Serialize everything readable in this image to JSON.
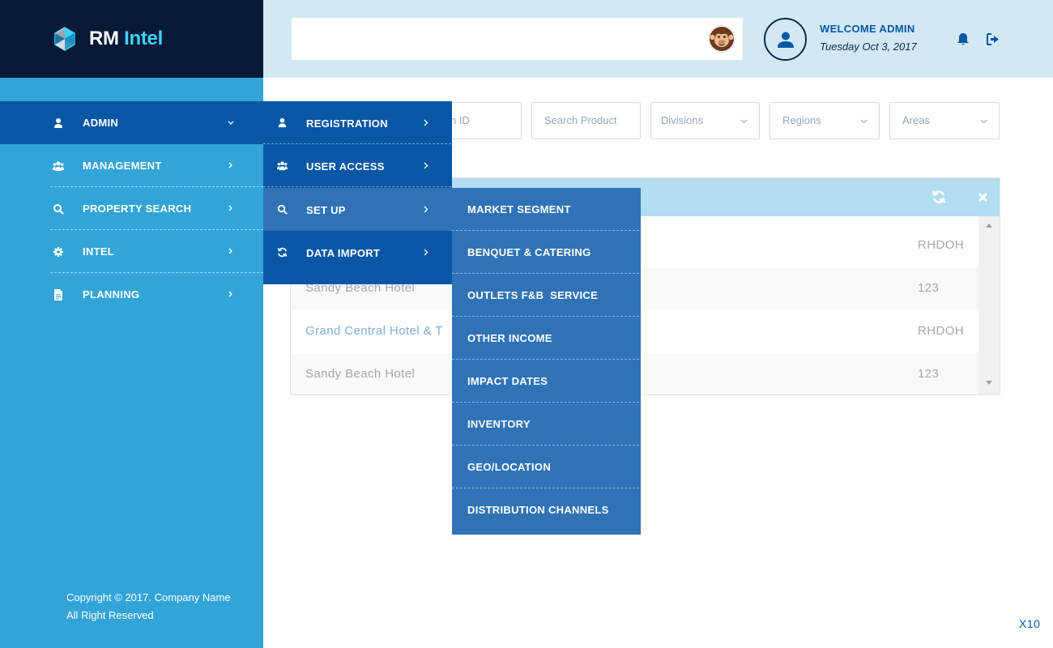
{
  "brand": {
    "name_part1": "RM",
    "name_part2": "Intel"
  },
  "sidebar": {
    "items": [
      {
        "label": "ADMIN",
        "icon": "user-icon",
        "active": true
      },
      {
        "label": "MANAGEMENT",
        "icon": "users-icon"
      },
      {
        "label": "PROPERTY SEARCH",
        "icon": "search-icon"
      },
      {
        "label": "INTEL",
        "icon": "gear-icon"
      },
      {
        "label": "PLANNING",
        "icon": "document-icon"
      }
    ],
    "copyright_line1": "Copyright © 2017. Company Name",
    "copyright_line2": "All Right Reserved"
  },
  "header": {
    "search_value": "",
    "welcome": "WELCOME ADMIN",
    "date": "Tuesday Oct 3, 2017"
  },
  "filters": {
    "id_partial": "n ID",
    "product": "Search Product",
    "divisions": "Divisions",
    "regions": "Regions",
    "areas": "Areas"
  },
  "admin_submenu": {
    "items": [
      {
        "label": "REGISTRATION",
        "icon": "user-icon"
      },
      {
        "label": "USER ACCESS",
        "icon": "users-icon"
      },
      {
        "label": "SET UP",
        "icon": "search-icon",
        "hover": true
      },
      {
        "label": "DATA IMPORT",
        "icon": "refresh-icon"
      }
    ]
  },
  "setup_submenu": {
    "items": [
      "MARKET SEGMENT",
      "BENQUET & CATERING",
      "OUTLETS F&B  SERVICE",
      "OTHER INCOME",
      "IMPACT DATES",
      "INVENTORY",
      "GEO/LOCATION",
      "DISTRIBUTION CHANNELS"
    ]
  },
  "table": {
    "rows": [
      {
        "name": "",
        "code": "RHDOH"
      },
      {
        "name": "Sandy Beach Hotel",
        "code": "123"
      },
      {
        "name": "Grand Central Hotel & T",
        "code": "RHDOH"
      },
      {
        "name": "Sandy Beach Hotel",
        "code": "123"
      }
    ]
  },
  "footer": {
    "version": "X10"
  },
  "colors": {
    "sidebar": "#32a4d8",
    "brand_bg": "#061a36",
    "active": "#0757a6",
    "submenu_hover": "#2f73b6",
    "header_bg": "#d2e9f5",
    "panel_head": "#b3ddf1",
    "accent": "#3fd0f5"
  }
}
